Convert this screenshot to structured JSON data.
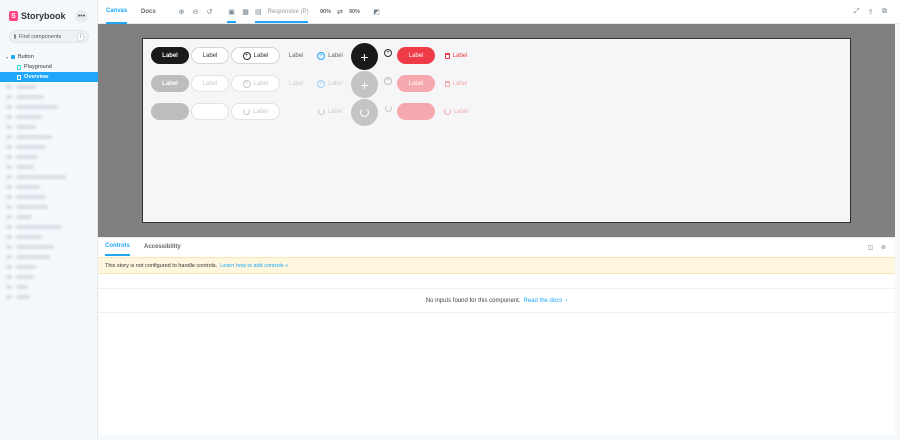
{
  "sidebar": {
    "brand": "Storybook",
    "menu_icon": "ellipsis-icon",
    "search_placeholder": "Find components",
    "search_shortcut": "/",
    "tree": {
      "group": "Button",
      "stories": [
        "Playground",
        "Overview"
      ],
      "active_story": "Overview"
    }
  },
  "toolbar": {
    "tabs": [
      "Canvas",
      "Docs"
    ],
    "active_tab": "Canvas",
    "viewport": "Responsive (P)",
    "width": "90%",
    "swap_icon": "⇄",
    "height": "90%"
  },
  "preview": {
    "button_label": "Label",
    "add_icon": "+",
    "rows": [
      "default",
      "disabled",
      "loading"
    ]
  },
  "addons": {
    "tabs": [
      "Controls",
      "Accessibility"
    ],
    "active_tab": "Controls",
    "warning_text": "This story is not configured to handle controls.",
    "warning_link": "Learn how to add controls »",
    "empty_text": "No inputs found for this component.",
    "empty_link": "Read the docs",
    "empty_link_arrow": "›"
  },
  "colors": {
    "accent": "#1ea7fd",
    "brand": "#ff4785",
    "danger": "#ef3a47"
  }
}
